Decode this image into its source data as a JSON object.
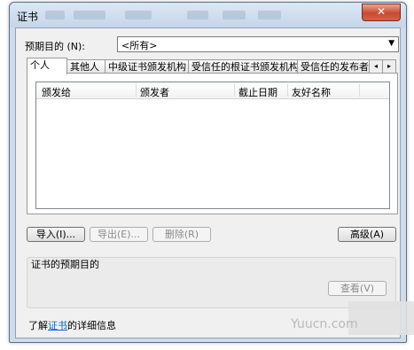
{
  "window": {
    "title": "证书",
    "close_symbol": "✕"
  },
  "purpose": {
    "label": "预期目的 (N):",
    "selected": "<所有>"
  },
  "tabs": [
    {
      "label": "个人"
    },
    {
      "label": "其他人"
    },
    {
      "label": "中级证书颁发机构"
    },
    {
      "label": "受信任的根证书颁发机构"
    },
    {
      "label": "受信任的发布者"
    }
  ],
  "tab_scroll": {
    "left": "◂",
    "right": "▸"
  },
  "table": {
    "columns": [
      "颁发给",
      "颁发者",
      "截止日期",
      "友好名称"
    ]
  },
  "buttons": {
    "import": "导入(I)...",
    "export": "导出(E)...",
    "remove": "删除(R)",
    "advanced": "高级(A)",
    "view": "查看(V)"
  },
  "group": {
    "label": "证书的预期目的"
  },
  "footer": {
    "prefix": "了解",
    "link": "证书",
    "suffix": "的详细信息"
  },
  "watermark": "Yuucn.com"
}
